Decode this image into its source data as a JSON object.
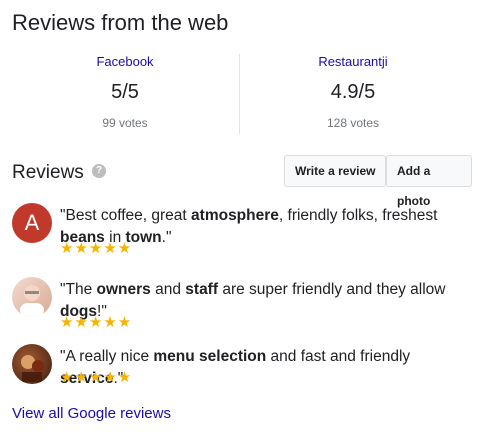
{
  "header": {
    "title": "Reviews from the web"
  },
  "sources": [
    {
      "name": "Facebook",
      "score": "5/5",
      "votes": "99 votes"
    },
    {
      "name": "Restaurantji",
      "score": "4.9/5",
      "votes": "128 votes"
    }
  ],
  "reviews_section": {
    "title": "Reviews",
    "help_icon": "?",
    "write_button": "Write a review",
    "add_photo_button": "Add a photo"
  },
  "reviews": [
    {
      "avatar_letter": "A",
      "rating": "★★★★★",
      "stars": 5,
      "text_parts": [
        {
          "t": "\"Best coffee, great ",
          "b": false
        },
        {
          "t": "atmosphere",
          "b": true
        },
        {
          "t": ", friendly folks, freshest ",
          "b": false
        },
        {
          "t": "beans",
          "b": true
        },
        {
          "t": " in ",
          "b": false
        },
        {
          "t": "town",
          "b": true
        },
        {
          "t": ".\"",
          "b": false
        }
      ]
    },
    {
      "rating": "★★★★★",
      "stars": 5,
      "text_parts": [
        {
          "t": "\"The ",
          "b": false
        },
        {
          "t": "owners",
          "b": true
        },
        {
          "t": " and ",
          "b": false
        },
        {
          "t": "staff",
          "b": true
        },
        {
          "t": " are super friendly and they allow ",
          "b": false
        },
        {
          "t": "dogs",
          "b": true
        },
        {
          "t": "!\"",
          "b": false
        }
      ]
    },
    {
      "rating": "★★★★★",
      "stars": 5,
      "text_parts": [
        {
          "t": "\"A really nice ",
          "b": false
        },
        {
          "t": "menu selection",
          "b": true
        },
        {
          "t": " and fast and friendly ",
          "b": false
        },
        {
          "t": "service",
          "b": true
        },
        {
          "t": ".\"",
          "b": false
        }
      ]
    }
  ],
  "footer": {
    "all_reviews_link": "View all Google reviews"
  },
  "colors": {
    "link": "#1a0dab",
    "star": "#f4b400",
    "avatar_a": "#c0392b"
  }
}
